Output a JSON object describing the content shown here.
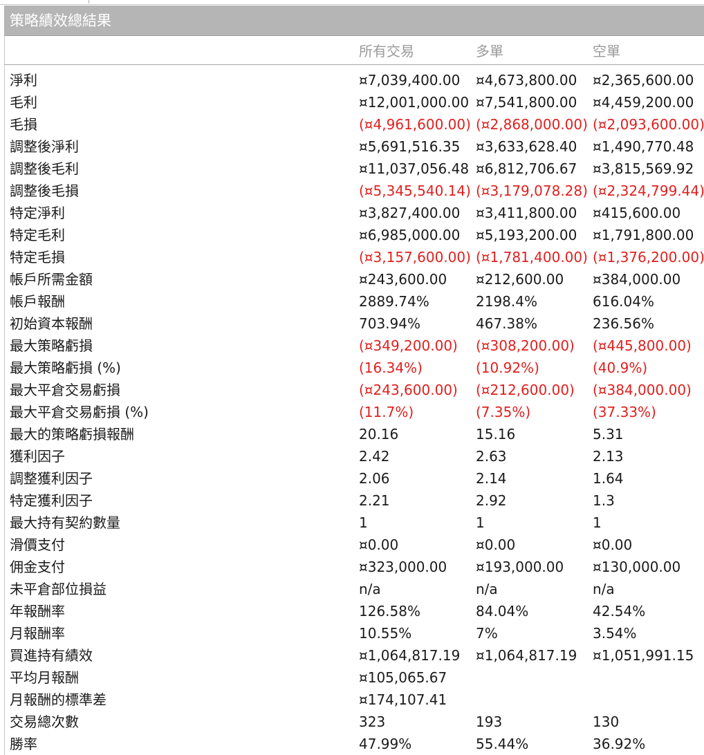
{
  "title": "策略績效總結果",
  "columns": {
    "all": "所有交易",
    "long": "多單",
    "short": "空單"
  },
  "colors": {
    "title_bar": "#b5b5b5",
    "negative": "#e0201e",
    "header_text": "#9a9a9a"
  },
  "rows": [
    {
      "label": "淨利",
      "all": "¤7,039,400.00",
      "long": "¤4,673,800.00",
      "short": "¤2,365,600.00",
      "negative": false
    },
    {
      "label": "毛利",
      "all": "¤12,001,000.00",
      "long": "¤7,541,800.00",
      "short": "¤4,459,200.00",
      "negative": false
    },
    {
      "label": "毛損",
      "all": "(¤4,961,600.00)",
      "long": "(¤2,868,000.00)",
      "short": "(¤2,093,600.00)",
      "negative": true
    },
    {
      "label": "調整後淨利",
      "all": "¤5,691,516.35",
      "long": "¤3,633,628.40",
      "short": "¤1,490,770.48",
      "negative": false
    },
    {
      "label": "調整後毛利",
      "all": "¤11,037,056.48",
      "long": "¤6,812,706.67",
      "short": "¤3,815,569.92",
      "negative": false
    },
    {
      "label": "調整後毛損",
      "all": "(¤5,345,540.14)",
      "long": "(¤3,179,078.28)",
      "short": "(¤2,324,799.44)",
      "negative": true
    },
    {
      "label": "特定淨利",
      "all": "¤3,827,400.00",
      "long": "¤3,411,800.00",
      "short": "¤415,600.00",
      "negative": false
    },
    {
      "label": "特定毛利",
      "all": "¤6,985,000.00",
      "long": "¤5,193,200.00",
      "short": "¤1,791,800.00",
      "negative": false
    },
    {
      "label": "特定毛損",
      "all": "(¤3,157,600.00)",
      "long": "(¤1,781,400.00)",
      "short": "(¤1,376,200.00)",
      "negative": true
    },
    {
      "label": "帳戶所需金額",
      "all": "¤243,600.00",
      "long": "¤212,600.00",
      "short": "¤384,000.00",
      "negative": false
    },
    {
      "label": "帳戶報酬",
      "all": "2889.74%",
      "long": "2198.4%",
      "short": "616.04%",
      "negative": false
    },
    {
      "label": "初始資本報酬",
      "all": "703.94%",
      "long": "467.38%",
      "short": "236.56%",
      "negative": false
    },
    {
      "label": "最大策略虧損",
      "all": "(¤349,200.00)",
      "long": "(¤308,200.00)",
      "short": "(¤445,800.00)",
      "negative": true
    },
    {
      "label": "最大策略虧損 (%)",
      "all": "(16.34%)",
      "long": "(10.92%)",
      "short": "(40.9%)",
      "negative": true
    },
    {
      "label": "最大平倉交易虧損",
      "all": "(¤243,600.00)",
      "long": "(¤212,600.00)",
      "short": "(¤384,000.00)",
      "negative": true
    },
    {
      "label": "最大平倉交易虧損 (%)",
      "all": "(11.7%)",
      "long": "(7.35%)",
      "short": "(37.33%)",
      "negative": true
    },
    {
      "label": "最大的策略虧損報酬",
      "all": "20.16",
      "long": "15.16",
      "short": "5.31",
      "negative": false
    },
    {
      "label": "獲利因子",
      "all": "2.42",
      "long": "2.63",
      "short": "2.13",
      "negative": false
    },
    {
      "label": "調整獲利因子",
      "all": "2.06",
      "long": "2.14",
      "short": "1.64",
      "negative": false
    },
    {
      "label": "特定獲利因子",
      "all": "2.21",
      "long": "2.92",
      "short": "1.3",
      "negative": false
    },
    {
      "label": "最大持有契約數量",
      "all": "1",
      "long": "1",
      "short": "1",
      "negative": false
    },
    {
      "label": "滑價支付",
      "all": "¤0.00",
      "long": "¤0.00",
      "short": "¤0.00",
      "negative": false
    },
    {
      "label": "佣金支付",
      "all": "¤323,000.00",
      "long": "¤193,000.00",
      "short": "¤130,000.00",
      "negative": false
    },
    {
      "label": "未平倉部位損益",
      "all": "n/a",
      "long": "n/a",
      "short": "n/a",
      "negative": false
    },
    {
      "label": "年報酬率",
      "all": "126.58%",
      "long": "84.04%",
      "short": "42.54%",
      "negative": false
    },
    {
      "label": "月報酬率",
      "all": "10.55%",
      "long": "7%",
      "short": "3.54%",
      "negative": false
    },
    {
      "label": "買進持有績效",
      "all": "¤1,064,817.19",
      "long": "¤1,064,817.19",
      "short": "¤1,051,991.15",
      "negative": false
    },
    {
      "label": "平均月報酬",
      "all": "¤105,065.67",
      "long": "",
      "short": "",
      "negative": false
    },
    {
      "label": "月報酬的標準差",
      "all": "¤174,107.41",
      "long": "",
      "short": "",
      "negative": false
    },
    {
      "label": "交易總次數",
      "all": "323",
      "long": "193",
      "short": "130",
      "negative": false
    },
    {
      "label": "勝率",
      "all": "47.99%",
      "long": "55.44%",
      "short": "36.92%",
      "negative": false
    }
  ]
}
